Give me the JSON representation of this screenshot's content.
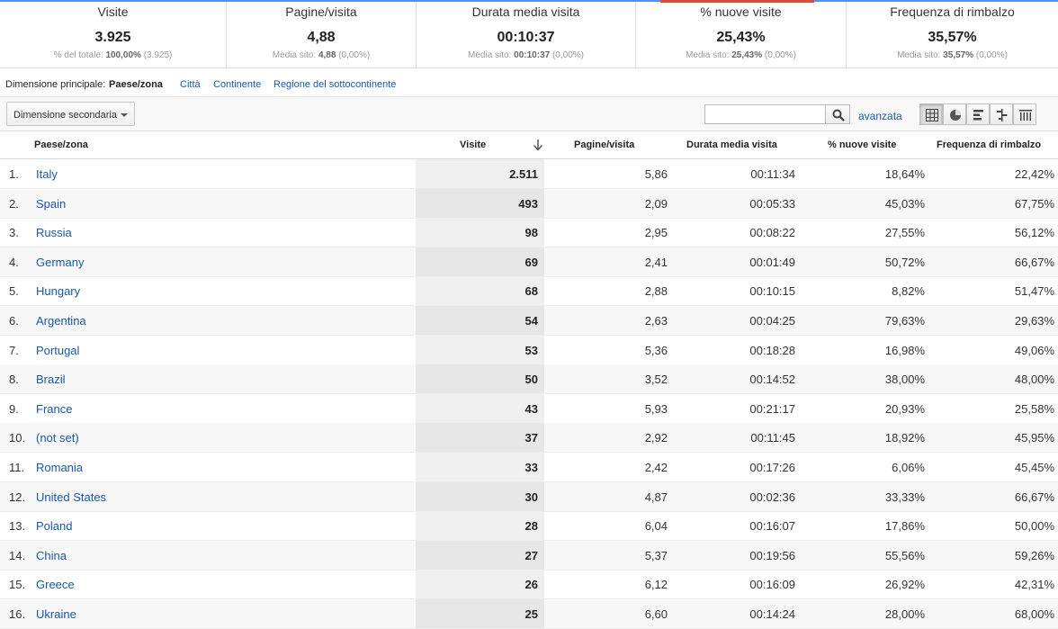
{
  "summary": {
    "metrics": [
      {
        "label": "Visite",
        "value": "3.925",
        "sub_prefix": "% del totale:",
        "sub_bold": "100,00%",
        "sub_suffix": "(3.925)"
      },
      {
        "label": "Pagine/visita",
        "value": "4,88",
        "sub_prefix": "Media sito:",
        "sub_bold": "4,88",
        "sub_suffix": "(0,00%)"
      },
      {
        "label": "Durata media visita",
        "value": "00:10:37",
        "sub_prefix": "Media sito:",
        "sub_bold": "00:10:37",
        "sub_suffix": "(0,00%)"
      },
      {
        "label": "% nuove visite",
        "value": "25,43%",
        "sub_prefix": "Media sito:",
        "sub_bold": "25,43%",
        "sub_suffix": "(0,00%)"
      },
      {
        "label": "Frequenza di rimbalzo",
        "value": "35,57%",
        "sub_prefix": "Media sito:",
        "sub_bold": "35,57%",
        "sub_suffix": "(0,00%)"
      }
    ]
  },
  "dimensions": {
    "label": "Dimensione principale:",
    "active": "Paese/zona",
    "links": [
      "Città",
      "Continente",
      "Regione del sottocontinente"
    ]
  },
  "toolbar": {
    "secondary_dimension": "Dimensione secondaria",
    "search_value": "",
    "advanced_label": "avanzata",
    "icons": [
      "search-icon",
      "table-view-icon",
      "pie-view-icon",
      "performance-view-icon",
      "comparison-view-icon",
      "pivot-view-icon"
    ]
  },
  "table": {
    "columns": [
      "Paese/zona",
      "Visite",
      "Pagine/visita",
      "Durata media visita",
      "% nuove visite",
      "Frequenza di rimbalzo"
    ],
    "rows": [
      {
        "idx": "1.",
        "name": "Italy",
        "visits": "2.511",
        "ppv": "5,86",
        "dur": "00:11:34",
        "new": "18,64%",
        "bounce": "22,42%"
      },
      {
        "idx": "2.",
        "name": "Spain",
        "visits": "493",
        "ppv": "2,09",
        "dur": "00:05:33",
        "new": "45,03%",
        "bounce": "67,75%"
      },
      {
        "idx": "3.",
        "name": "Russia",
        "visits": "98",
        "ppv": "2,95",
        "dur": "00:08:22",
        "new": "27,55%",
        "bounce": "56,12%"
      },
      {
        "idx": "4.",
        "name": "Germany",
        "visits": "69",
        "ppv": "2,41",
        "dur": "00:01:49",
        "new": "50,72%",
        "bounce": "66,67%"
      },
      {
        "idx": "5.",
        "name": "Hungary",
        "visits": "68",
        "ppv": "2,88",
        "dur": "00:10:15",
        "new": "8,82%",
        "bounce": "51,47%"
      },
      {
        "idx": "6.",
        "name": "Argentina",
        "visits": "54",
        "ppv": "2,63",
        "dur": "00:04:25",
        "new": "79,63%",
        "bounce": "29,63%"
      },
      {
        "idx": "7.",
        "name": "Portugal",
        "visits": "53",
        "ppv": "5,36",
        "dur": "00:18:28",
        "new": "16,98%",
        "bounce": "49,06%"
      },
      {
        "idx": "8.",
        "name": "Brazil",
        "visits": "50",
        "ppv": "3,52",
        "dur": "00:14:52",
        "new": "38,00%",
        "bounce": "48,00%"
      },
      {
        "idx": "9.",
        "name": "France",
        "visits": "43",
        "ppv": "5,93",
        "dur": "00:21:17",
        "new": "20,93%",
        "bounce": "25,58%"
      },
      {
        "idx": "10.",
        "name": "(not set)",
        "visits": "37",
        "ppv": "2,92",
        "dur": "00:11:45",
        "new": "18,92%",
        "bounce": "45,95%"
      },
      {
        "idx": "11.",
        "name": "Romania",
        "visits": "33",
        "ppv": "2,42",
        "dur": "00:17:26",
        "new": "6,06%",
        "bounce": "45,45%"
      },
      {
        "idx": "12.",
        "name": "United States",
        "visits": "30",
        "ppv": "4,87",
        "dur": "00:02:36",
        "new": "33,33%",
        "bounce": "66,67%"
      },
      {
        "idx": "13.",
        "name": "Poland",
        "visits": "28",
        "ppv": "6,04",
        "dur": "00:16:07",
        "new": "17,86%",
        "bounce": "50,00%"
      },
      {
        "idx": "14.",
        "name": "China",
        "visits": "27",
        "ppv": "5,37",
        "dur": "00:19:56",
        "new": "55,56%",
        "bounce": "59,26%"
      },
      {
        "idx": "15.",
        "name": "Greece",
        "visits": "26",
        "ppv": "6,12",
        "dur": "00:16:09",
        "new": "26,92%",
        "bounce": "42,31%"
      },
      {
        "idx": "16.",
        "name": "Ukraine",
        "visits": "25",
        "ppv": "6,60",
        "dur": "00:14:24",
        "new": "28,00%",
        "bounce": "68,00%"
      }
    ]
  },
  "colors": {
    "link": "#1a57a8",
    "accent_blue": "#4d90fe",
    "accent_red": "#dd4b39"
  }
}
